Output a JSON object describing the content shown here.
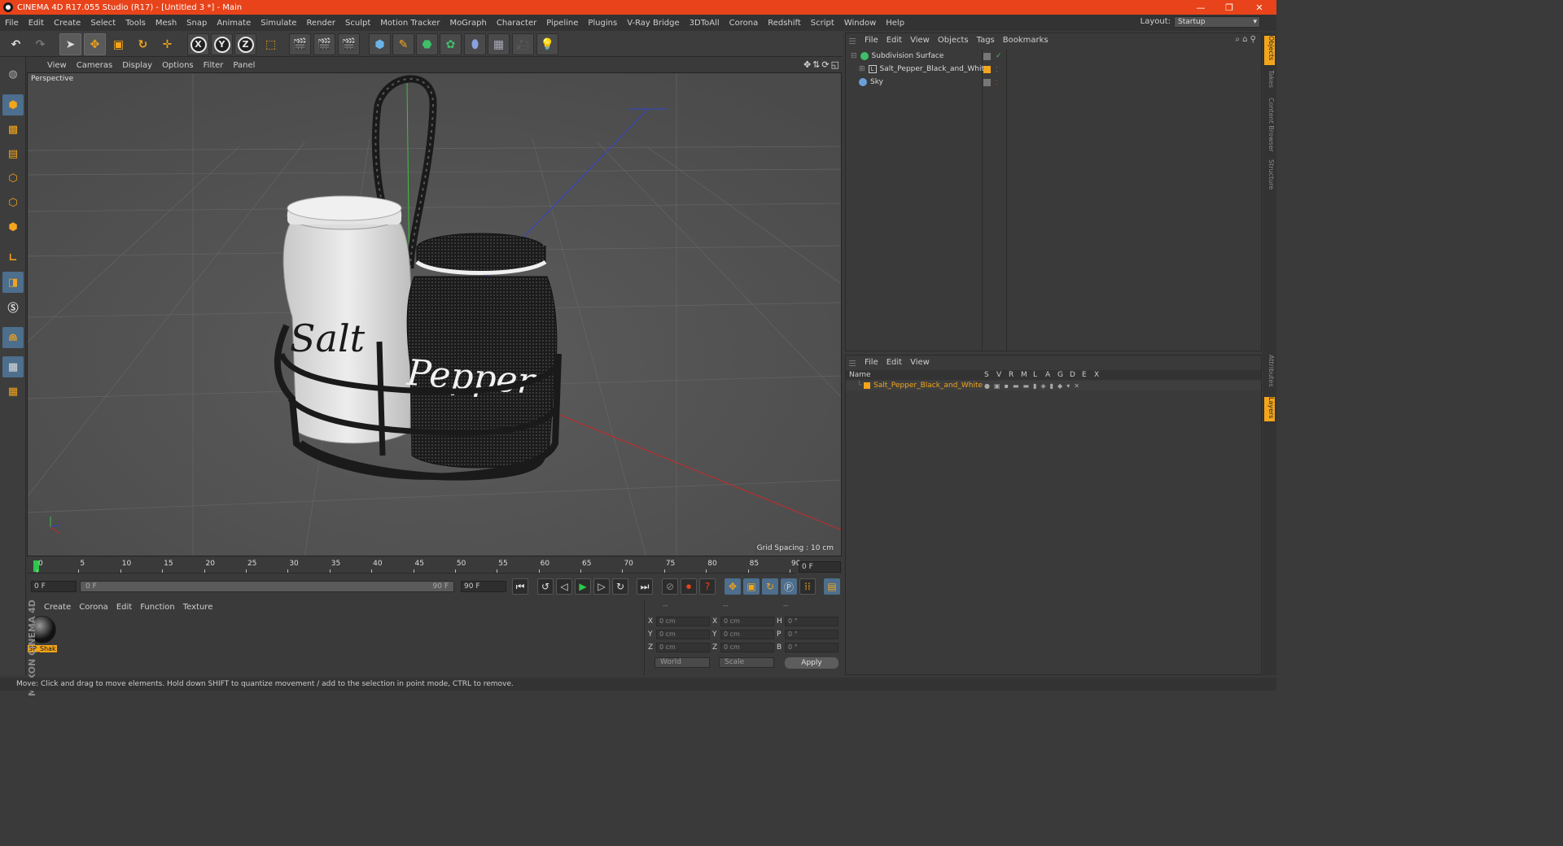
{
  "window": {
    "title": "CINEMA 4D R17.055 Studio (R17) - [Untitled 3 *] - Main",
    "controls": [
      "—",
      "❐",
      "✕"
    ]
  },
  "menubar": {
    "items": [
      "File",
      "Edit",
      "Create",
      "Select",
      "Tools",
      "Mesh",
      "Snap",
      "Animate",
      "Simulate",
      "Render",
      "Sculpt",
      "Motion Tracker",
      "MoGraph",
      "Character",
      "Pipeline",
      "Plugins",
      "V-Ray Bridge",
      "3DToAll",
      "Corona",
      "Redshift",
      "Script",
      "Window",
      "Help"
    ],
    "layout_label": "Layout:",
    "layout_value": "Startup"
  },
  "toolbar": {
    "axis_x": "X",
    "axis_y": "Y",
    "axis_z": "Z"
  },
  "viewport": {
    "menu": [
      "View",
      "Cameras",
      "Display",
      "Options",
      "Filter",
      "Panel"
    ],
    "camera_label": "Perspective",
    "grid_spacing": "Grid Spacing : 10 cm",
    "salt_text": "Salt",
    "pepper_text": "Pepper"
  },
  "timeline": {
    "ticks": [
      "0",
      "5",
      "10",
      "15",
      "20",
      "25",
      "30",
      "35",
      "40",
      "45",
      "50",
      "55",
      "60",
      "65",
      "70",
      "75",
      "80",
      "85",
      "90"
    ],
    "current_frame": "0 F",
    "start_frame": "0 F",
    "slider_start": "0 F",
    "slider_end": "90 F",
    "end_frame": "90 F"
  },
  "materials": {
    "menu": [
      "Create",
      "Corona",
      "Edit",
      "Function",
      "Texture"
    ],
    "items": [
      {
        "name": "SP_Shak"
      }
    ],
    "branding": "MAXON CINEMA 4D"
  },
  "coordinates": {
    "headers": [
      "--",
      "--",
      "--"
    ],
    "rows": [
      {
        "l1": "X",
        "v1": "0 cm",
        "l2": "X",
        "v2": "0 cm",
        "l3": "H",
        "v3": "0 °"
      },
      {
        "l1": "Y",
        "v1": "0 cm",
        "l2": "Y",
        "v2": "0 cm",
        "l3": "P",
        "v3": "0 °"
      },
      {
        "l1": "Z",
        "v1": "0 cm",
        "l2": "Z",
        "v2": "0 cm",
        "l3": "B",
        "v3": "0 °"
      }
    ],
    "mode1": "World",
    "mode2": "Scale",
    "apply": "Apply"
  },
  "status_bar": "Move: Click and drag to move elements. Hold down SHIFT to quantize movement / add to the selection in point mode, CTRL to remove.",
  "object_manager": {
    "menu": [
      "File",
      "Edit",
      "View",
      "Objects",
      "Tags",
      "Bookmarks"
    ],
    "objects": [
      {
        "name": "Subdivision Surface",
        "color": "#3fbf6a"
      },
      {
        "name": "Salt_Pepper_Black_and_White",
        "color": "#f3a51b"
      },
      {
        "name": "Sky",
        "color": "#6aa0d8"
      }
    ]
  },
  "right_tabs": [
    "Objects",
    "Takes",
    "Content Browser",
    "Structure",
    "Attributes",
    "Layers"
  ],
  "layer_manager": {
    "menu": [
      "File",
      "Edit",
      "View"
    ],
    "columns": [
      "Name",
      "S",
      "V",
      "R",
      "M",
      "L",
      "A",
      "G",
      "D",
      "E",
      "X"
    ],
    "layers": [
      {
        "name": "Salt_Pepper_Black_and_White",
        "color": "#f3a51b"
      }
    ]
  },
  "colors": {
    "titlebar": "#e8431a",
    "accent_orange": "#f3a51b",
    "active_blue": "#4d6e8c"
  }
}
